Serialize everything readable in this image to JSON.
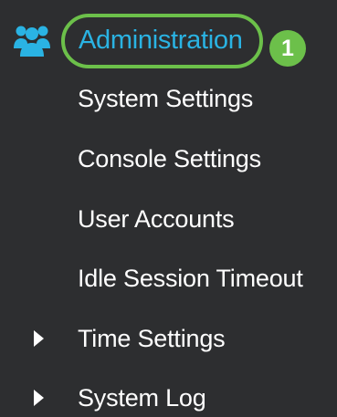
{
  "menu": {
    "section": {
      "icon": "users-icon",
      "label": "Administration",
      "step_badge": "1"
    },
    "items": [
      {
        "label": "System Settings",
        "expandable": false
      },
      {
        "label": "Console Settings",
        "expandable": false
      },
      {
        "label": "User Accounts",
        "expandable": false
      },
      {
        "label": "Idle Session Timeout",
        "expandable": false
      },
      {
        "label": "Time Settings",
        "expandable": true,
        "icon": "caret-right-icon"
      },
      {
        "label": "System Log",
        "expandable": true,
        "icon": "caret-right-icon"
      }
    ]
  },
  "colors": {
    "background": "#2d2e30",
    "accent": "#2ab3e3",
    "highlight": "#6cc04a",
    "text": "#ffffff"
  }
}
